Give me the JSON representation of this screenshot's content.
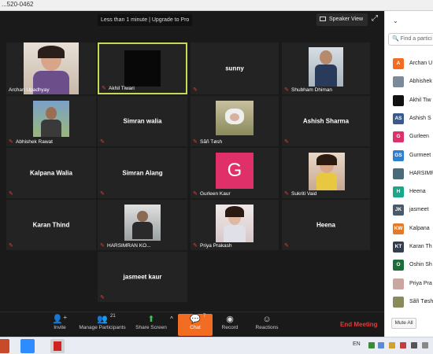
{
  "window": {
    "title": "...520-0462"
  },
  "top": {
    "banner": "Less than 1 minute | Upgrade to Pro",
    "speaker_view": "Speaker View"
  },
  "tiles": [
    {
      "name": "Archan Upadhyay",
      "type": "photo"
    },
    {
      "name": "Akhil Tiwari",
      "type": "photo",
      "active": true
    },
    {
      "name": "sunny",
      "type": "name",
      "display": "sunny"
    },
    {
      "name": "Shubham Dhiman",
      "type": "photo"
    },
    {
      "name": "Abhishek Rawat",
      "type": "photo"
    },
    {
      "name": "Simran walia",
      "type": "name",
      "display": "Simran walia"
    },
    {
      "name": "Sãñ Tøsh",
      "type": "photo"
    },
    {
      "name": "Ashish Sharma",
      "type": "name",
      "display": "Ashish Sharma"
    },
    {
      "name": "Kalpana Walia",
      "type": "name",
      "display": "Kalpana Walia"
    },
    {
      "name": "Simran Alang",
      "type": "name",
      "display": "Simran Alang"
    },
    {
      "name": "Gurleen Kaur",
      "type": "avatar",
      "letter": "G",
      "color": "#e0306a"
    },
    {
      "name": "Sukriti Vaid",
      "type": "photo"
    },
    {
      "name": "Karan Thind",
      "type": "name",
      "display": "Karan Thind"
    },
    {
      "name": "HARSIMRAN KO...",
      "type": "photo"
    },
    {
      "name": "Priya Prakash",
      "type": "photo"
    },
    {
      "name": "Heena",
      "type": "name",
      "display": "Heena"
    },
    {
      "name": "jasmeet kaur",
      "type": "name",
      "display": "jasmeet kaur"
    }
  ],
  "toolbar": {
    "invite": "Invite",
    "manage_participants": "Manage Participants",
    "participant_count": "21",
    "share_screen": "Share Screen",
    "chat": "Chat",
    "chat_count": "7",
    "record": "Record",
    "reactions": "Reactions",
    "end_meeting": "End Meeting"
  },
  "sidebar": {
    "search_placeholder": "Find a partici",
    "participants": [
      {
        "initials": "A",
        "name": "Archan U",
        "color": "#f26d21"
      },
      {
        "initials": "",
        "name": "Abhishek",
        "color": "#7a8a99"
      },
      {
        "initials": "",
        "name": "Akhil Tiw",
        "color": "#111111"
      },
      {
        "initials": "AS",
        "name": "Ashish S",
        "color": "#3a5a8c"
      },
      {
        "initials": "G",
        "name": "Gurleen",
        "color": "#e0306a"
      },
      {
        "initials": "GS",
        "name": "Gurmeet",
        "color": "#2f7fd0"
      },
      {
        "initials": "",
        "name": "HARSIMR",
        "color": "#4a6a7a"
      },
      {
        "initials": "H",
        "name": "Heena",
        "color": "#1aa88a"
      },
      {
        "initials": "JK",
        "name": "jasmeet",
        "color": "#4a5a6a"
      },
      {
        "initials": "KW",
        "name": "Kalpana",
        "color": "#e27a2a"
      },
      {
        "initials": "KT",
        "name": "Karan Th",
        "color": "#333f4f"
      },
      {
        "initials": "O",
        "name": "Oshin Sh",
        "color": "#1f6b3a"
      },
      {
        "initials": "",
        "name": "Priya Pra",
        "color": "#c9a6a0"
      },
      {
        "initials": "",
        "name": "Sãñ Tøsh",
        "color": "#8a8a5a"
      }
    ],
    "mute_all": "Mute All"
  },
  "taskbar": {
    "lang": "EN"
  }
}
